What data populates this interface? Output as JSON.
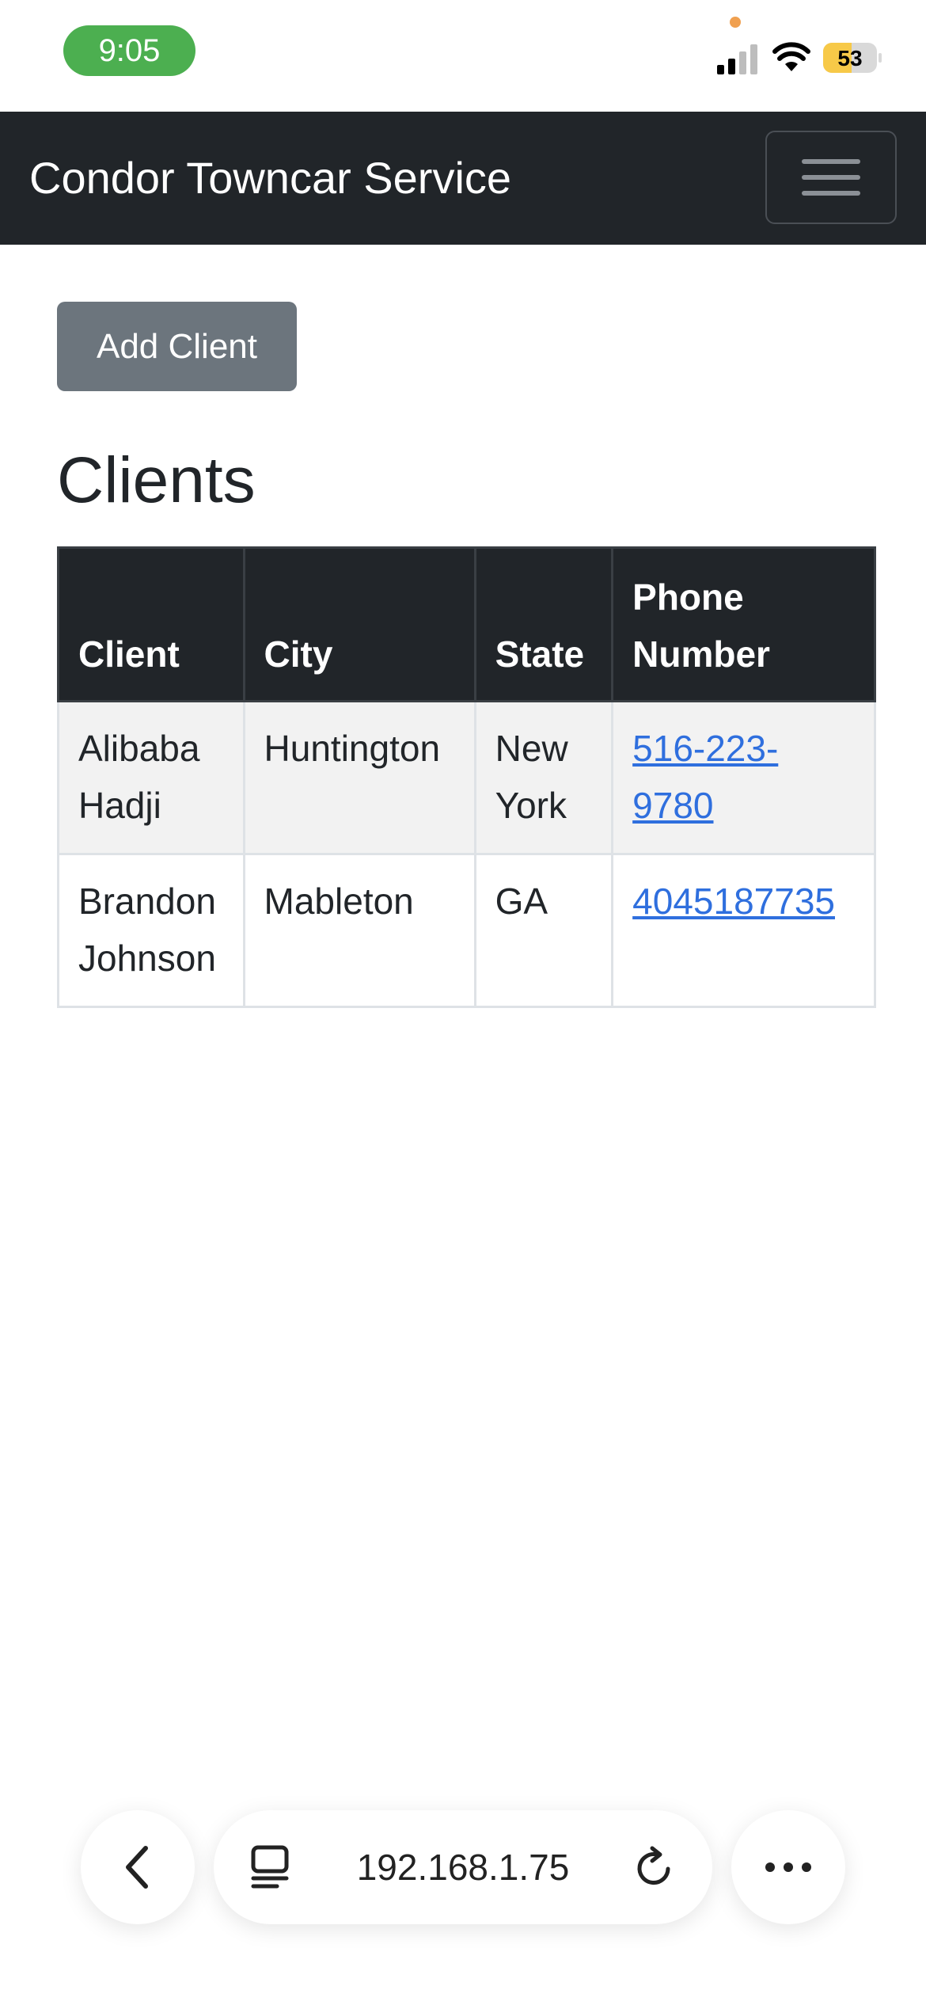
{
  "status_bar": {
    "time": "9:05",
    "battery": "53"
  },
  "navbar": {
    "brand": "Condor Towncar Service"
  },
  "actions": {
    "add_client_label": "Add Client"
  },
  "page": {
    "heading": "Clients"
  },
  "table": {
    "headers": {
      "client": "Client",
      "city": "City",
      "state": "State",
      "phone": "Phone Number"
    },
    "rows": [
      {
        "client": "Alibaba Hadji",
        "city": "Huntington",
        "state": "New York",
        "phone": "516-223-9780"
      },
      {
        "client": "Brandon Johnson",
        "city": "Mableton",
        "state": "GA",
        "phone": "4045187735"
      }
    ]
  },
  "browser": {
    "url": "192.168.1.75"
  },
  "colors": {
    "navbar_bg": "#212529",
    "button_bg": "#6c757d",
    "link": "#2f6fde",
    "time_pill": "#4caf50",
    "battery_fill": "#f7c948"
  }
}
